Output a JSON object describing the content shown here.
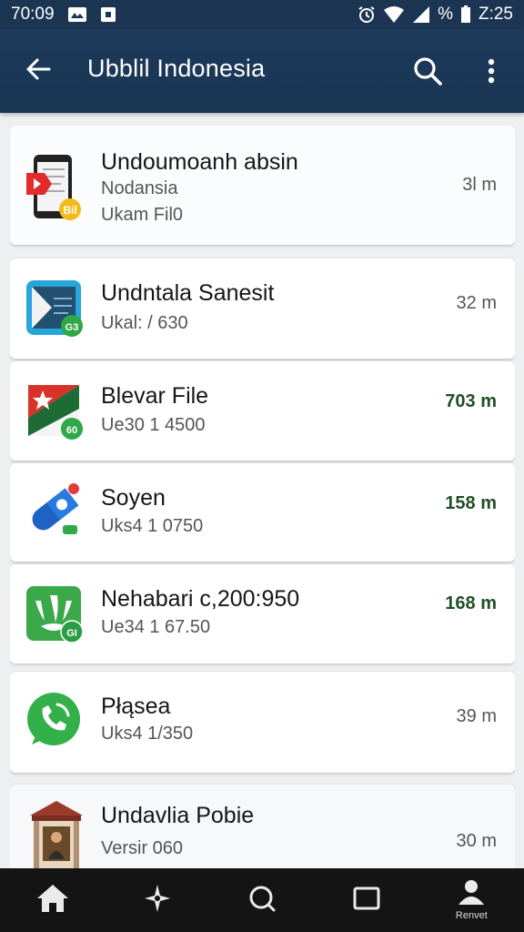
{
  "status_bar": {
    "time": "70:09",
    "battery_percent": "%",
    "clock_right": "Z:25",
    "icons": [
      "gallery-icon",
      "image-icon",
      "alarm-icon",
      "wifi-icon",
      "signal-icon",
      "battery-icon"
    ]
  },
  "header": {
    "title": "Ubblil Indonesia",
    "icons": [
      "back-arrow-icon",
      "search-icon",
      "more-vertical-icon"
    ]
  },
  "apps": [
    {
      "name": "Undoumoanh absin",
      "line2": "Nodansia",
      "line3": "Ukam Fil0",
      "size": "3l m",
      "size_color": "gray",
      "icon": "phone-file-icon"
    },
    {
      "name": "Undntala Sanesit",
      "line2": "Ukal: / 630",
      "size": "32 m",
      "size_color": "gray",
      "icon": "video-play-icon"
    },
    {
      "name": "Blevar File",
      "line2": "Ue30 1 4500",
      "size": "703 m",
      "size_color": "green",
      "icon": "flag-file-icon"
    },
    {
      "name": "Soyen",
      "line2": "Uks4 1 0750",
      "size": "158 m",
      "size_color": "green",
      "icon": "capsule-icon"
    },
    {
      "name": "Nehabari c,200:950",
      "line2": "Ue34 1 67.50",
      "size": "168 m",
      "size_color": "green",
      "icon": "paw-icon"
    },
    {
      "name": "Płąsea",
      "line2": "Uks4 1/350",
      "size": "39 m",
      "size_color": "gray",
      "icon": "phone-chat-icon"
    },
    {
      "name": "Undavlia Pobie",
      "line2": "Versir 060",
      "size": "30 m",
      "size_color": "gray",
      "icon": "museum-icon"
    }
  ],
  "bottom_nav": {
    "items": [
      {
        "icon": "home-icon",
        "label": ""
      },
      {
        "icon": "sparkle-icon",
        "label": ""
      },
      {
        "icon": "search-icon",
        "label": ""
      },
      {
        "icon": "square-icon",
        "label": ""
      },
      {
        "icon": "person-icon",
        "label": "Renvet"
      }
    ]
  },
  "colors": {
    "header_bg": "#1b3553",
    "green_size": "#1f4f26",
    "nav_bg": "#141414"
  }
}
